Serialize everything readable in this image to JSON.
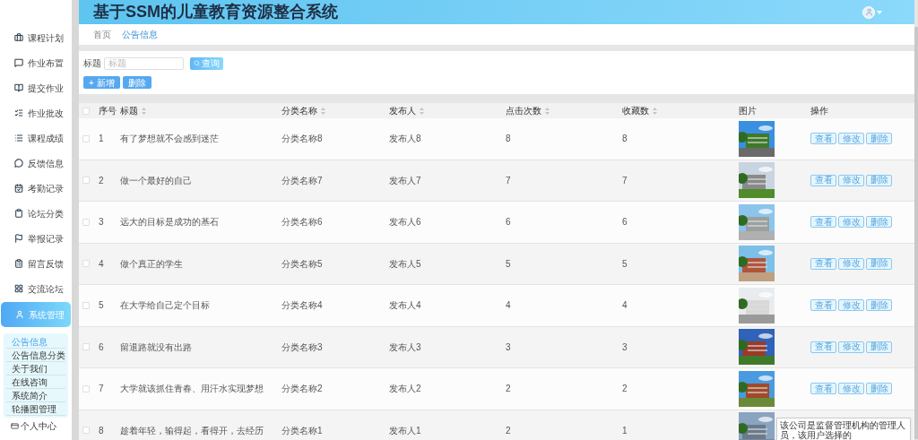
{
  "app": {
    "title": "基于SSM的儿童教育资源整合系统"
  },
  "sidebar": {
    "items": [
      {
        "label": "课程计划",
        "selected": false
      },
      {
        "label": "作业布置",
        "selected": false
      },
      {
        "label": "提交作业",
        "selected": false
      },
      {
        "label": "作业批改",
        "selected": false
      },
      {
        "label": "课程成绩",
        "selected": false
      },
      {
        "label": "反馈信息",
        "selected": false
      },
      {
        "label": "考勤记录",
        "selected": false
      },
      {
        "label": "论坛分类",
        "selected": false
      },
      {
        "label": "举报记录",
        "selected": false
      },
      {
        "label": "留言反馈",
        "selected": false
      },
      {
        "label": "交流论坛",
        "selected": false
      },
      {
        "label": "系统管理",
        "selected": true,
        "expanded": true,
        "children": [
          {
            "label": "公告信息",
            "selected": true
          },
          {
            "label": "公告信息分类",
            "selected": false
          },
          {
            "label": "关于我们",
            "selected": false
          },
          {
            "label": "在线咨询",
            "selected": false
          },
          {
            "label": "系统简介",
            "selected": false
          },
          {
            "label": "轮播图管理",
            "selected": false
          }
        ]
      }
    ],
    "footer": "个人中心"
  },
  "breadcrumb": [
    {
      "label": "首页",
      "selected": false
    },
    {
      "label": "公告信息",
      "selected": true
    }
  ],
  "search": {
    "label": "标题",
    "placeholder": "标题",
    "button": "查询"
  },
  "actions": [
    "+ 新增",
    "删除"
  ],
  "table": {
    "columns": [
      {
        "label": "序号",
        "sortable": false
      },
      {
        "label": "标题",
        "sortable": true
      },
      {
        "label": "分类名称",
        "sortable": true
      },
      {
        "label": "发布人",
        "sortable": true
      },
      {
        "label": "点击次数",
        "sortable": true
      },
      {
        "label": "收藏数",
        "sortable": true
      },
      {
        "label": "图片",
        "sortable": false
      },
      {
        "label": "操作",
        "sortable": false
      }
    ],
    "header_checked": false,
    "rows": [
      {
        "checked": false,
        "cells": [
          "1",
          "有了梦想就不会感到迷茫",
          "分类名称8",
          "发布人8",
          "8",
          "8"
        ],
        "buttons": [
          "查看",
          "修改",
          "删除"
        ]
      },
      {
        "checked": false,
        "cells": [
          "2",
          "做一个最好的自己",
          "分类名称7",
          "发布人7",
          "7",
          "7"
        ],
        "buttons": [
          "查看",
          "修改",
          "删除"
        ]
      },
      {
        "checked": false,
        "cells": [
          "3",
          "远大的目标是成功的基石",
          "分类名称6",
          "发布人6",
          "6",
          "6"
        ],
        "buttons": [
          "查看",
          "修改",
          "删除"
        ]
      },
      {
        "checked": false,
        "cells": [
          "4",
          "做个真正的学生",
          "分类名称5",
          "发布人5",
          "5",
          "5"
        ],
        "buttons": [
          "查看",
          "修改",
          "删除"
        ]
      },
      {
        "checked": false,
        "cells": [
          "5",
          "在大学给自己定个目标",
          "分类名称4",
          "发布人4",
          "4",
          "4"
        ],
        "buttons": [
          "查看",
          "修改",
          "删除"
        ]
      },
      {
        "checked": false,
        "cells": [
          "6",
          "留退路就没有出路",
          "分类名称3",
          "发布人3",
          "3",
          "3"
        ],
        "buttons": [
          "查看",
          "修改",
          "删除"
        ]
      },
      {
        "checked": false,
        "cells": [
          "7",
          "大学就该抓住青春、用汗水实现梦想",
          "分类名称2",
          "发布人2",
          "2",
          "2"
        ],
        "buttons": [
          "查看",
          "修改",
          "删除"
        ]
      },
      {
        "checked": false,
        "cells": [
          "8",
          "趁着年轻，输得起，看得开，去经历",
          "分类名称1",
          "发布人1",
          "2",
          "1"
        ]
      }
    ]
  },
  "tooltip": "该公司是监督管理机构的管理人员，该用户选择的"
}
